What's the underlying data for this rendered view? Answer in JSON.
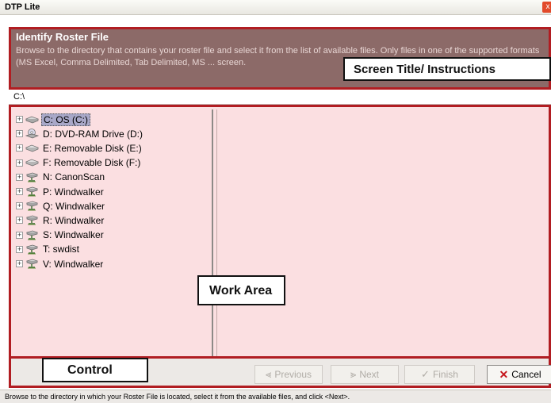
{
  "window": {
    "title": "DTP Lite",
    "close_glyph": "x"
  },
  "header": {
    "title": "Identify Roster File",
    "instructions": "Browse to the directory that contains your roster file and select it from the list of available files. Only files in one of the supported formats (MS Excel, Comma Delimited, Tab Delimited, MS ... screen."
  },
  "annotations": {
    "screen_title": "Screen Title/ Instructions",
    "work_area": "Work Area",
    "control": "Control"
  },
  "path": "C:\\",
  "tree": {
    "items": [
      {
        "label": "C: OS (C:)",
        "icon": "hard-drive-icon",
        "selected": true
      },
      {
        "label": "D: DVD-RAM Drive (D:)",
        "icon": "dvd-drive-icon",
        "selected": false
      },
      {
        "label": "E: Removable Disk (E:)",
        "icon": "removable-disk-icon",
        "selected": false
      },
      {
        "label": "F: Removable Disk (F:)",
        "icon": "removable-disk-icon",
        "selected": false
      },
      {
        "label": "N: CanonScan",
        "icon": "network-drive-icon",
        "selected": false
      },
      {
        "label": "P: Windwalker",
        "icon": "network-drive-icon",
        "selected": false
      },
      {
        "label": "Q: Windwalker",
        "icon": "network-drive-icon",
        "selected": false
      },
      {
        "label": "R: Windwalker",
        "icon": "network-drive-icon",
        "selected": false
      },
      {
        "label": "S: Windwalker",
        "icon": "network-drive-icon",
        "selected": false
      },
      {
        "label": "T: swdist",
        "icon": "network-drive-icon",
        "selected": false
      },
      {
        "label": "V: Windwalker",
        "icon": "network-drive-icon",
        "selected": false
      }
    ],
    "expander_glyph": "+"
  },
  "controls": {
    "previous": {
      "label": "Previous",
      "glyph": "⪡",
      "enabled": false
    },
    "next": {
      "label": "Next",
      "glyph": "⪢",
      "enabled": false
    },
    "finish": {
      "label": "Finish",
      "glyph": "✓",
      "enabled": false
    },
    "cancel": {
      "label": "Cancel",
      "glyph": "✕",
      "enabled": true
    }
  },
  "status": "Browse to the directory in which your Roster File is located, select it from the available files, and click <Next>.",
  "colors": {
    "accent_border": "#b11d22",
    "header_bg": "#8c6a68",
    "work_bg": "#fbdfe1"
  }
}
